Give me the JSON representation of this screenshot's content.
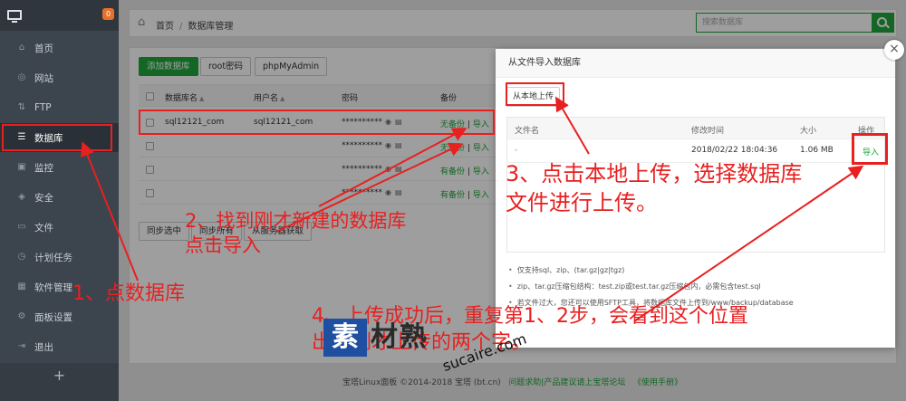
{
  "sidebar": {
    "badge": "0",
    "items": [
      {
        "label": "首页",
        "icon": "home-icon"
      },
      {
        "label": "网站",
        "icon": "globe-icon"
      },
      {
        "label": "FTP",
        "icon": "ftp-icon"
      },
      {
        "label": "数据库",
        "icon": "database-icon"
      },
      {
        "label": "监控",
        "icon": "monitor-icon"
      },
      {
        "label": "安全",
        "icon": "shield-icon"
      },
      {
        "label": "文件",
        "icon": "folder-icon"
      },
      {
        "label": "计划任务",
        "icon": "clock-icon"
      },
      {
        "label": "软件管理",
        "icon": "grid-icon"
      },
      {
        "label": "面板设置",
        "icon": "gear-icon"
      },
      {
        "label": "退出",
        "icon": "logout-icon"
      }
    ],
    "add_label": "+"
  },
  "header": {
    "breadcrumb_home": "首页",
    "breadcrumb_sep": "/",
    "breadcrumb_current": "数据库管理",
    "search_placeholder": "搜索数据库"
  },
  "toolbar": {
    "add_db": "添加数据库",
    "root_pwd": "root密码",
    "phpmyadmin": "phpMyAdmin"
  },
  "table": {
    "headers": {
      "name": "数据库名",
      "user": "用户名",
      "password": "密码",
      "backup": "备份"
    },
    "rows": [
      {
        "name": "sql12121_com",
        "user": "sql12121_com",
        "password": "**********",
        "backup": "无备份",
        "import": "导入"
      },
      {
        "name": "",
        "user": "",
        "password": "**********",
        "backup": "无备份",
        "import": "导入"
      },
      {
        "name": "",
        "user": "",
        "password": "**********",
        "backup": "有备份",
        "import": "导入"
      },
      {
        "name": "",
        "user": "",
        "password": "**********",
        "backup": "有备份",
        "import": "导入"
      }
    ],
    "sep": "|",
    "sync_selected": "同步选中",
    "sync_all": "同步所有",
    "from_server": "从服务器获取"
  },
  "footer": {
    "copyright": "宝塔Linux面板 ©2014-2018 宝塔 (bt.cn)",
    "links": "问题求助|产品建议请上宝塔论坛",
    "manual": "《使用手册》"
  },
  "modal": {
    "title": "从文件导入数据库",
    "close": "×",
    "upload_btn": "从本地上传",
    "file_headers": {
      "name": "文件名",
      "mtime": "修改时间",
      "size": "大小",
      "action": "操作"
    },
    "file_row": {
      "name": "-",
      "mtime": "2018/02/22 18:04:36",
      "size": "1.06 MB",
      "action": "导入"
    },
    "notes": [
      "仅支持sql、zip、(tar.gz|gz|tgz)",
      "zip、tar.gz压缩包结构：test.zip或test.tar.gz压缩包内，必需包含test.sql",
      "若文件过大，您还可以使用SFTP工具，将数据库文件上传到/www/backup/database"
    ]
  },
  "annotations": {
    "step1": "1、点数据库",
    "step2_line1": "2、找到刚才新建的数据库",
    "step2_line2": "点击导入",
    "step3_line1": "3、点击本地上传，选择数据库",
    "step3_line2": "文件进行上传。",
    "step4_line1": "4、上传成功后，重复第1、2步，会看到这个位置",
    "step4_line2": "出现刚才上传的两个字。",
    "color": "#e82020"
  },
  "watermark": {
    "logo": "素",
    "text": "材熟",
    "url": "sucaire.com"
  }
}
